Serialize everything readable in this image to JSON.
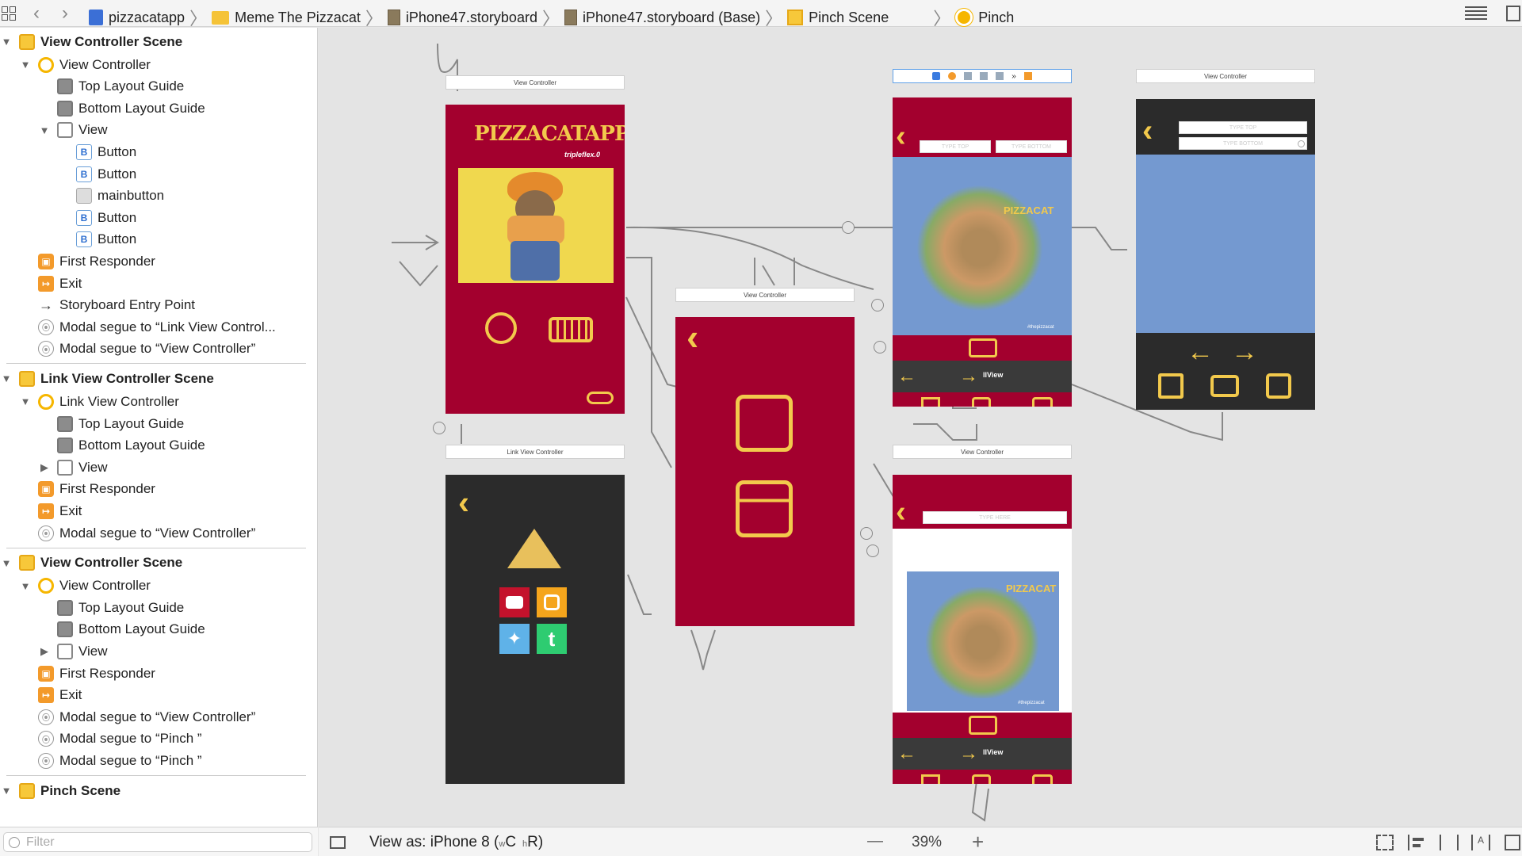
{
  "breadcrumb": [
    {
      "label": "pizzacatapp",
      "icon": "project-icon"
    },
    {
      "label": "Meme The Pizzacat",
      "icon": "folder-icon"
    },
    {
      "label": "iPhone47.storyboard",
      "icon": "storyboard-file-icon"
    },
    {
      "label": "iPhone47.storyboard (Base)",
      "icon": "storyboard-file-icon"
    },
    {
      "label": "Pinch Scene",
      "icon": "scene-icon"
    },
    {
      "label": "Pinch",
      "icon": "view-controller-icon"
    }
  ],
  "outline": [
    {
      "label": "View Controller Scene",
      "type": "scene",
      "level": 0,
      "tri": "▼"
    },
    {
      "label": "View Controller",
      "type": "vc",
      "level": 1,
      "tri": "▼"
    },
    {
      "label": "Top Layout Guide",
      "type": "guide",
      "level": 2,
      "tri": ""
    },
    {
      "label": "Bottom Layout Guide",
      "type": "guide",
      "level": 2,
      "tri": ""
    },
    {
      "label": "View",
      "type": "view",
      "level": 2,
      "tri": "▼"
    },
    {
      "label": "Button",
      "type": "button",
      "level": 3,
      "tri": ""
    },
    {
      "label": "Button",
      "type": "button",
      "level": 3,
      "tri": ""
    },
    {
      "label": "mainbutton",
      "type": "image",
      "level": 3,
      "tri": ""
    },
    {
      "label": "Button",
      "type": "button",
      "level": 3,
      "tri": ""
    },
    {
      "label": "Button",
      "type": "button",
      "level": 3,
      "tri": ""
    },
    {
      "label": "First Responder",
      "type": "responder",
      "level": 1,
      "tri": ""
    },
    {
      "label": "Exit",
      "type": "exit",
      "level": 1,
      "tri": ""
    },
    {
      "label": "Storyboard Entry Point",
      "type": "arrow",
      "level": 1,
      "tri": ""
    },
    {
      "label": "Modal segue to “Link View Control...",
      "type": "segue",
      "level": 1,
      "tri": ""
    },
    {
      "label": "Modal segue to “View Controller”",
      "type": "segue",
      "level": 1,
      "tri": ""
    },
    {
      "label": "Link View Controller Scene",
      "type": "scene",
      "level": 0,
      "tri": "▼"
    },
    {
      "label": "Link View Controller",
      "type": "vc",
      "level": 1,
      "tri": "▼"
    },
    {
      "label": "Top Layout Guide",
      "type": "guide",
      "level": 2,
      "tri": ""
    },
    {
      "label": "Bottom Layout Guide",
      "type": "guide",
      "level": 2,
      "tri": ""
    },
    {
      "label": "View",
      "type": "view",
      "level": 2,
      "tri": "▶"
    },
    {
      "label": "First Responder",
      "type": "responder",
      "level": 1,
      "tri": ""
    },
    {
      "label": "Exit",
      "type": "exit",
      "level": 1,
      "tri": ""
    },
    {
      "label": "Modal segue to “View Controller”",
      "type": "segue",
      "level": 1,
      "tri": ""
    },
    {
      "label": "View Controller Scene",
      "type": "scene",
      "level": 0,
      "tri": "▼"
    },
    {
      "label": "View Controller",
      "type": "vc",
      "level": 1,
      "tri": "▼"
    },
    {
      "label": "Top Layout Guide",
      "type": "guide",
      "level": 2,
      "tri": ""
    },
    {
      "label": "Bottom Layout Guide",
      "type": "guide",
      "level": 2,
      "tri": ""
    },
    {
      "label": "View",
      "type": "view",
      "level": 2,
      "tri": "▶"
    },
    {
      "label": "First Responder",
      "type": "responder",
      "level": 1,
      "tri": ""
    },
    {
      "label": "Exit",
      "type": "exit",
      "level": 1,
      "tri": ""
    },
    {
      "label": "Modal segue to “View Controller”",
      "type": "segue",
      "level": 1,
      "tri": ""
    },
    {
      "label": "Modal segue to “Pinch ”",
      "type": "segue",
      "level": 1,
      "tri": ""
    },
    {
      "label": "Modal segue to “Pinch ”",
      "type": "segue",
      "level": 1,
      "tri": ""
    },
    {
      "label": "Pinch    Scene",
      "type": "scene",
      "level": 0,
      "tri": "▼"
    }
  ],
  "filter": {
    "placeholder": "Filter"
  },
  "bottombar": {
    "view_as": "View as: iPhone 8 (",
    "size_w": "w",
    "size_c": "C",
    "size_h": "h",
    "size_r": "R)",
    "zoom": "39%",
    "minus": "—",
    "plus": "+"
  },
  "scenes": {
    "main_title": "View Controller",
    "link_title": "Link View Controller",
    "menu_title": "View Controller",
    "top_title": "View Controller",
    "bottom_title": "View Controller",
    "app_logo": "PIZZACATAPP",
    "app_sub": "tripleflex.0",
    "type_top": "TYPE TOP",
    "type_bottom": "TYPE BOTTOM",
    "type_here": "TYPE HERE",
    "pizzacat_watermark": "PIZZACAT",
    "hashtag": "#thepizzacat",
    "segment_label": "llView",
    "social": [
      "youtube",
      "instagram",
      "twitter",
      "tumblr"
    ]
  },
  "colors": {
    "crimson": "#a3002e",
    "yellow": "#f2c94c",
    "dark": "#2b2b2b",
    "blue": "#7499d0"
  }
}
